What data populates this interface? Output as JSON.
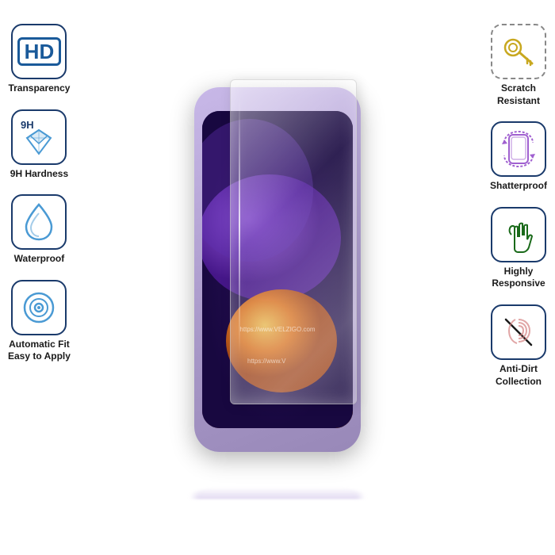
{
  "features": {
    "left": [
      {
        "id": "hd-transparency",
        "icon": "hd",
        "label": "Transparency"
      },
      {
        "id": "9h-hardness",
        "icon": "diamond",
        "label": "9H Hardness",
        "badge": "9H"
      },
      {
        "id": "waterproof",
        "icon": "drop",
        "label": "Waterproof"
      },
      {
        "id": "auto-fit",
        "icon": "target",
        "label": "Automatic Fit\nEasy to Apply"
      }
    ],
    "right": [
      {
        "id": "scratch-resistant",
        "icon": "key",
        "label": "Scratch\nResistant"
      },
      {
        "id": "shatterproof",
        "icon": "rotate",
        "label": "Shatterproof"
      },
      {
        "id": "highly-responsive",
        "icon": "touch",
        "label": "Highly\nResponsive"
      },
      {
        "id": "anti-dirt",
        "icon": "fingerprint",
        "label": "Anti-Dirt\nCollection"
      }
    ]
  },
  "watermark": "https://www.VELZIGO.com",
  "watermark2": "https://www.V"
}
